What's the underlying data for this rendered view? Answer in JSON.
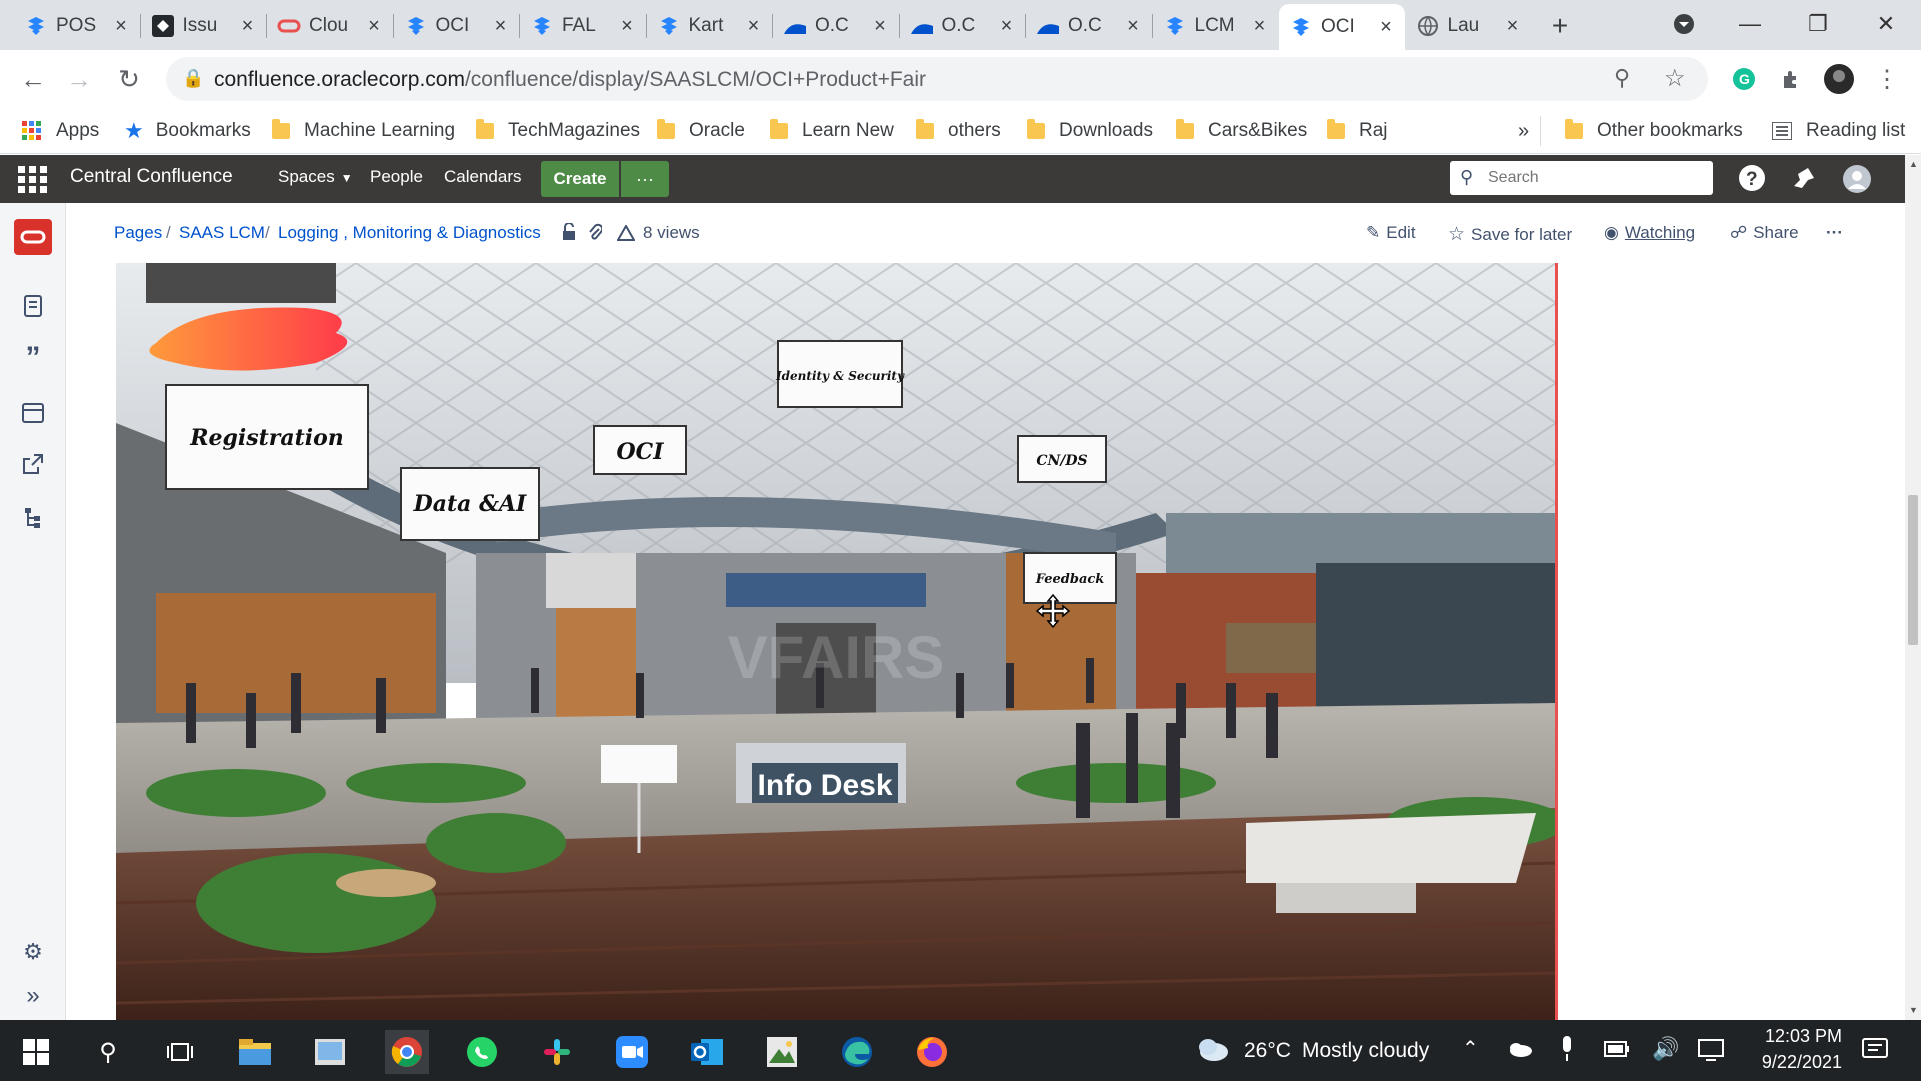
{
  "browser": {
    "tabs": [
      {
        "title": "POS",
        "icon": "jira-icon"
      },
      {
        "title": "Issu",
        "icon": "github-icon"
      },
      {
        "title": "Clou",
        "icon": "oracle-icon"
      },
      {
        "title": "OCI",
        "icon": "jira-icon"
      },
      {
        "title": "FAL",
        "icon": "jira-icon"
      },
      {
        "title": "Kart",
        "icon": "jira-icon"
      },
      {
        "title": "O.C",
        "icon": "confluence-icon"
      },
      {
        "title": "O.C",
        "icon": "confluence-icon"
      },
      {
        "title": "O.C",
        "icon": "confluence-icon"
      },
      {
        "title": "LCM",
        "icon": "jira-icon"
      },
      {
        "title": "OCI",
        "icon": "jira-icon"
      },
      {
        "title": "Lau",
        "icon": "globe-icon"
      }
    ],
    "url_host": "confluence.oraclecorp.com",
    "url_path": "/confluence/display/SAASLCM/OCI+Product+Fair",
    "bookmarks": [
      "Apps",
      "Bookmarks",
      "Machine Learning",
      "TechMagazines",
      "Oracle",
      "Learn New",
      "others",
      "Downloads",
      "Cars&Bikes",
      "Raj"
    ],
    "overflow": "»",
    "other_bookmarks": "Other bookmarks",
    "reading_list": "Reading list"
  },
  "confluence": {
    "brand": "Central Confluence",
    "nav": [
      "Spaces",
      "People",
      "Calendars"
    ],
    "create": "Create",
    "more": "···",
    "search_placeholder": "Search"
  },
  "page": {
    "breadcrumbs": [
      "Pages",
      "SAAS LCM",
      "Logging , Monitoring & Diagnostics"
    ],
    "views": "8 views",
    "actions": {
      "edit": "Edit",
      "save": "Save for later",
      "watch": "Watching",
      "share": "Share",
      "more": "···"
    }
  },
  "scene": {
    "signs": [
      "Registration",
      "Data &AI",
      "OCI",
      "Identity & Security",
      "CN/DS",
      "Feedback"
    ],
    "info_desk": "Info Desk",
    "watermark": "VFAIRS"
  },
  "taskbar": {
    "weather_temp": "26°C",
    "weather_text": "Mostly cloudy",
    "time": "12:03 PM",
    "date": "9/22/2021"
  }
}
